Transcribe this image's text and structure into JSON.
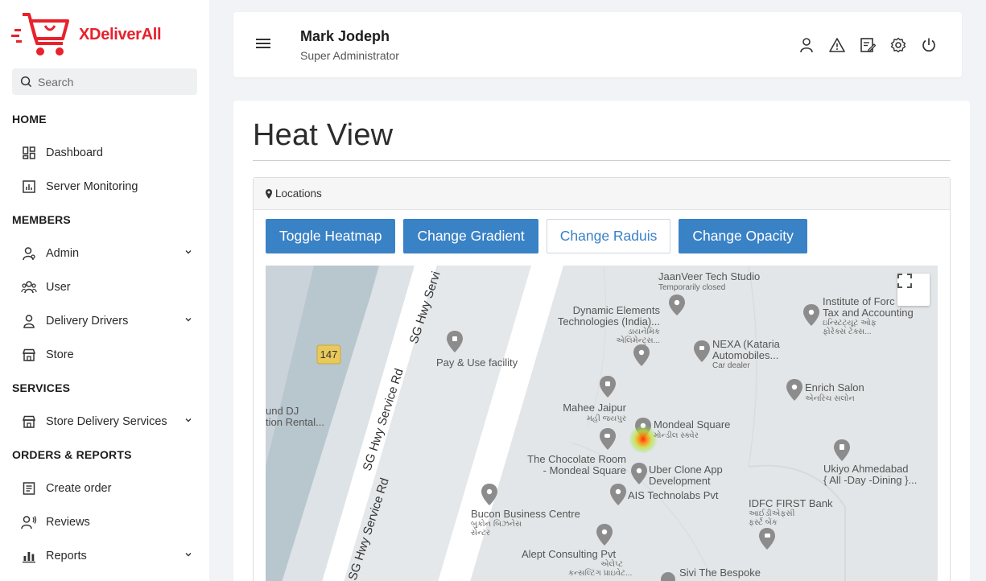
{
  "brand": {
    "name_x": "X",
    "name_rest": "DeliverAll"
  },
  "search": {
    "placeholder": "Search"
  },
  "sidebar": {
    "sections": {
      "home": "HOME",
      "members": "MEMBERS",
      "services": "SERVICES",
      "orders": "ORDERS & REPORTS"
    },
    "items": {
      "dashboard": "Dashboard",
      "server_monitoring": "Server Monitoring",
      "admin": "Admin",
      "user": "User",
      "delivery_drivers": "Delivery Drivers",
      "store": "Store",
      "store_delivery_services": "Store Delivery Services",
      "create_order": "Create order",
      "reviews": "Reviews",
      "reports": "Reports"
    }
  },
  "header": {
    "user_name": "Mark Jodeph",
    "user_role": "Super Administrator"
  },
  "page": {
    "title": "Heat View",
    "panel_title": "Locations"
  },
  "buttons": {
    "toggle_heatmap": "Toggle Heatmap",
    "change_gradient": "Change Gradient",
    "change_radius": "Change Raduis",
    "change_opacity": "Change Opacity"
  },
  "map": {
    "route_badge": "147",
    "labels": {
      "jaanveer": "JaanVeer Tech Studio",
      "jaanveer_sub": "Temporarily closed",
      "dynamic1": "Dynamic Elements",
      "dynamic2": "Technologies (India)...",
      "dynamic3": "ડાયનેમિક",
      "dynamic4": "એલિમેન્ટ્સ...",
      "institute1": "Institute of Forc",
      "institute2": "Tax and Accounting",
      "institute3": "ઇન્સ્ટિટ્યૂટ ઓફ",
      "institute4": "ફોરેક્સ ટૅક્સ...",
      "payuse": "Pay & Use facility",
      "nexa1": "NEXA (Kataria",
      "nexa2": "Automobiles...",
      "nexa3": "Car dealer",
      "enrich1": "Enrich Salon",
      "enrich2": "એનરિચ સલોન",
      "mahee1": "Mahee Jaipur",
      "mahee2": "મહી જયપુર",
      "mondeal1": "Mondeal Square",
      "mondeal2": "મોન્ડીલ સ્ક્વેર",
      "dj1": "und DJ",
      "dj2": "tion Rental...",
      "sg1": "SG Hwy Service Rd",
      "sg2": "SG Hwy Service Rd",
      "sg3": "SG Hwy Servi",
      "choco1": "The Chocolate Room",
      "choco2": "- Mondeal Square",
      "uber1": "Uber Clone App",
      "uber2": "Development",
      "ukiyo1": "Ukiyo Ahmedabad",
      "ukiyo2": "{ All -Day -Dining }...",
      "ais": "AIS Technolabs Pvt",
      "idfc1": "IDFC FIRST Bank",
      "idfc2": "આઈડીએફસી",
      "idfc3": "ફર્સ્ટ બેંક",
      "bucon1": "Bucon Business Centre",
      "bucon2": "બુકોન બિઝનેસ",
      "bucon3": "સેન્ટર",
      "alept1": "Alept Consulting Pvt",
      "alept2": "એલેપ્ટ",
      "alept3": "કન્સલ્ટિંગ પ્રાઇવેટ...",
      "sivi": "Sivi The Bespoke"
    }
  },
  "colors": {
    "brand_red": "#e8212b",
    "primary_blue": "#3a82c6"
  }
}
